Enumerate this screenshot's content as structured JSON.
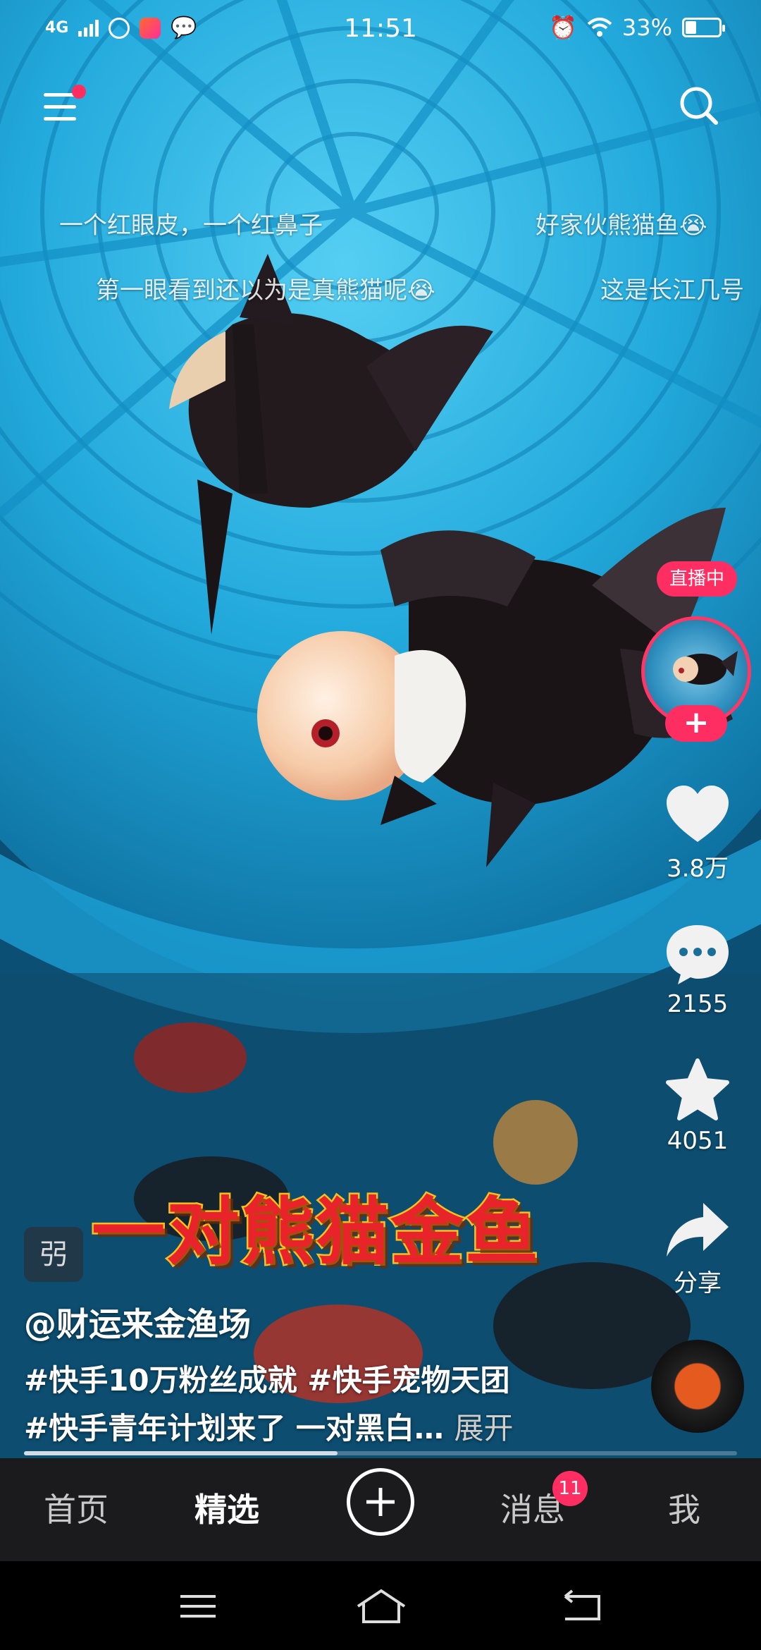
{
  "status_bar": {
    "network": "4G",
    "time": "11:51",
    "battery": "33%"
  },
  "danmaku": [
    "一个红眼皮，一个红鼻子",
    "好家伙熊猫鱼😭",
    "第一眼看到还以为是真熊猫呢😭",
    "这是长江几号"
  ],
  "right_rail": {
    "live_badge": "直播中",
    "follow_symbol": "+",
    "likes": "3.8万",
    "comments": "2155",
    "favorites": "4051",
    "share": "分享"
  },
  "video": {
    "overlay_title": "一对熊猫金鱼",
    "badge_text": "弜",
    "author": "@财运来金渔场",
    "description_line1": "#快手10万粉丝成就 #快手宠物天团",
    "description_line2": "#快手青年计划来了 一对黑白…",
    "expand": "展开",
    "progress": 0.44
  },
  "tabs": [
    {
      "label": "首页"
    },
    {
      "label": "精选"
    },
    {
      "label": "消息"
    },
    {
      "label": "我"
    }
  ],
  "message_badge": "11",
  "icons": {
    "menu": "menu-icon",
    "search": "search-icon",
    "like": "heart-icon",
    "comment": "comment-icon",
    "favorite": "star-icon",
    "share": "share-icon"
  },
  "colors": {
    "accent": "#ff2e62",
    "tabbar": "#1b1b1e"
  }
}
